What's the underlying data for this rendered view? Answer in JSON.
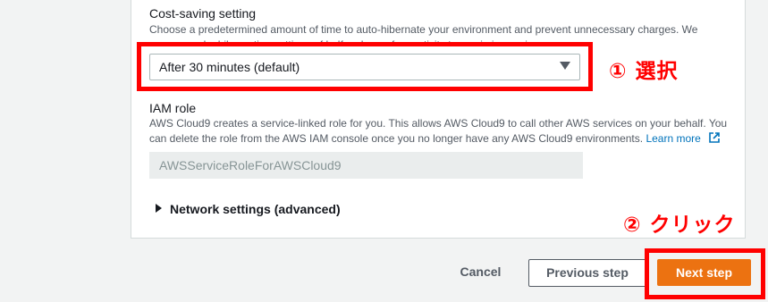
{
  "cost_saving": {
    "label": "Cost-saving setting",
    "description": "Choose a predetermined amount of time to auto-hibernate your environment and prevent unnecessary charges. We recommend a hibernation settings of half an hour of no activity to maximize savings.",
    "selected": "After 30 minutes (default)"
  },
  "iam_role": {
    "label": "IAM role",
    "description_line1": "AWS Cloud9 creates a service-linked role for you. This allows AWS Cloud9 to call other AWS services on your behalf. You",
    "description_line2": "can delete the role from the AWS IAM console once you no longer have any AWS Cloud9 environments.",
    "learn_more": "Learn more",
    "role_name": "AWSServiceRoleForAWSCloud9"
  },
  "network": {
    "label": "Network settings (advanced)"
  },
  "annotations": {
    "step1": "① 選択",
    "step2": "② クリック"
  },
  "footer": {
    "cancel": "Cancel",
    "previous": "Previous step",
    "next": "Next step"
  },
  "colors": {
    "annotation": "#ff0000",
    "primary_button": "#ec7211",
    "link": "#0073bb"
  }
}
